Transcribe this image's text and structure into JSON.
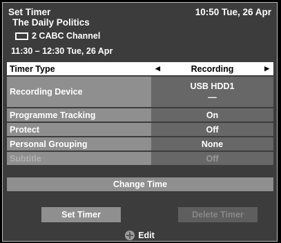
{
  "header": {
    "title": "Set Timer",
    "datetime": "10:50 Tue, 26 Apr",
    "programme": "The Daily Politics",
    "channel": "2 CABC Channel",
    "time_range": "11:30 – 12:30 Tue, 26 Apr"
  },
  "settings": [
    {
      "label": "Timer Type",
      "value": "Recording"
    },
    {
      "label": "Recording Device",
      "value": "USB HDD1",
      "sub_value": "—"
    },
    {
      "label": "Programme Tracking",
      "value": "On"
    },
    {
      "label": "Protect",
      "value": "Off"
    },
    {
      "label": "Personal Grouping",
      "value": "None"
    },
    {
      "label": "Subtitle",
      "value": "Off"
    }
  ],
  "change_time_label": "Change Time",
  "buttons": {
    "set_timer": "Set Timer",
    "delete_timer": "Delete Timer"
  },
  "footer": {
    "icon": "dpad-icon",
    "hint": "Edit"
  },
  "colors": {
    "background": "#3c3c3c",
    "row_label": "#8f8f8f",
    "row_value": "#676767",
    "selected": "#ffffff"
  }
}
